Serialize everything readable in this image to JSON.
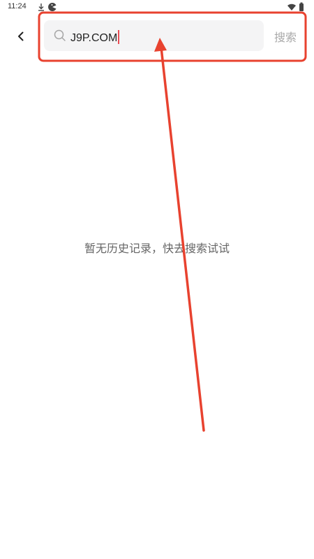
{
  "status_bar": {
    "time": "11:24",
    "icons": [
      "download-icon",
      "pacman-icon",
      "wifi-icon",
      "battery-icon"
    ]
  },
  "header": {
    "back_icon": "chevron-left-icon",
    "search": {
      "icon": "search-icon",
      "value": "J9P.COM"
    },
    "submit_label": "搜索"
  },
  "empty_state": {
    "message": "暂无历史记录，快去搜索试试"
  },
  "annotation": {
    "color": "#e8422f",
    "shapes": [
      "highlight-rectangle",
      "arrow"
    ]
  }
}
